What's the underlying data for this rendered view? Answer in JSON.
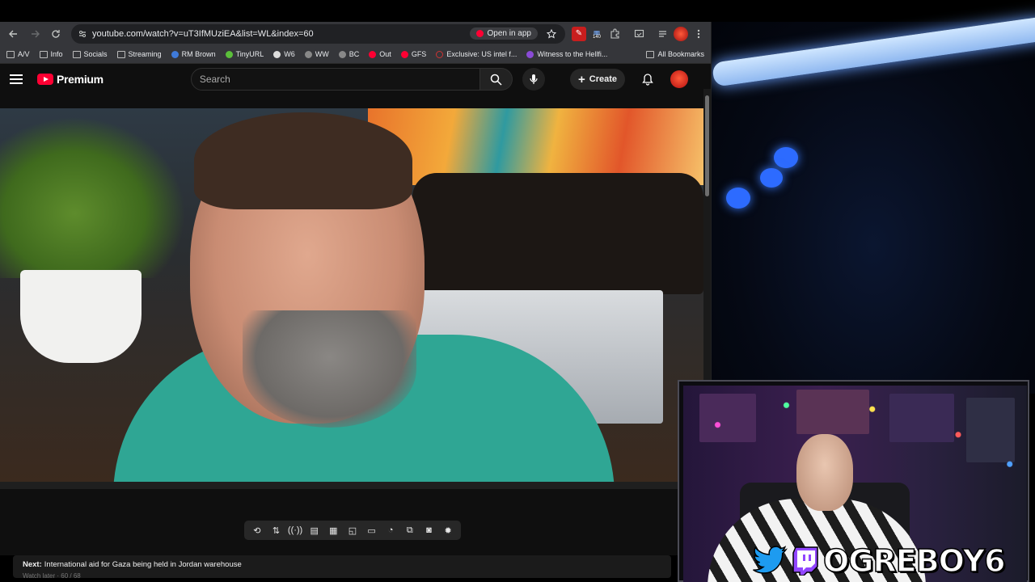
{
  "browser": {
    "url": "youtube.com/watch?v=uT3IfMUziEA&list=WL&index=60",
    "open_in_app": "Open in app",
    "extension_badge": "140",
    "bookmarks": [
      {
        "label": "A/V",
        "icon": "folder-icon"
      },
      {
        "label": "Info",
        "icon": "folder-icon"
      },
      {
        "label": "Socials",
        "icon": "folder-icon"
      },
      {
        "label": "Streaming",
        "icon": "folder-icon"
      },
      {
        "label": "RM Brown",
        "icon": "favicon"
      },
      {
        "label": "TinyURL",
        "icon": "favicon"
      },
      {
        "label": "W6",
        "icon": "favicon"
      },
      {
        "label": "WW",
        "icon": "favicon"
      },
      {
        "label": "BC",
        "icon": "favicon"
      },
      {
        "label": "Out",
        "icon": "youtube-icon"
      },
      {
        "label": "GFS",
        "icon": "youtube-icon"
      },
      {
        "label": "Exclusive: US intel f...",
        "icon": "favicon"
      },
      {
        "label": "Witness to the Hellfi...",
        "icon": "favicon"
      }
    ],
    "all_bookmarks": "All Bookmarks"
  },
  "youtube": {
    "logo_text": "Premium",
    "search_placeholder": "Search",
    "create_label": "Create",
    "next_label": "Next:",
    "next_title": "International aid for Gaza being held in Jordan warehouse",
    "next_sub": "Watch later · 60 / 68"
  },
  "overlay": {
    "handle": "OGREBOY6"
  },
  "colors": {
    "brand_red": "#ff0033",
    "page_bg": "#0f0f0f",
    "chrome_toolbar": "#35363a"
  }
}
